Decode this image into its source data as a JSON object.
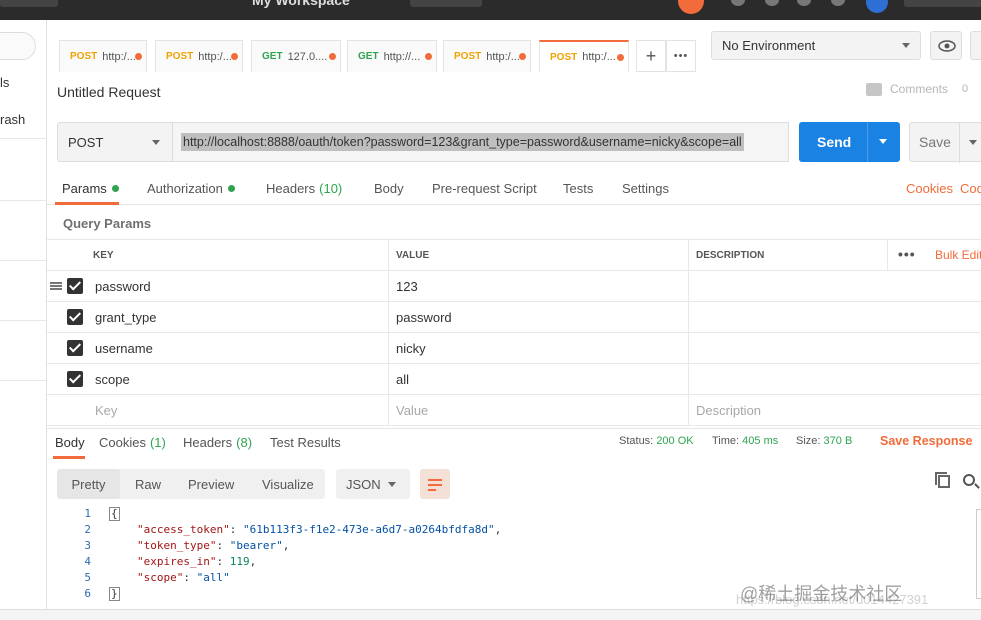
{
  "topbar": {
    "workspace": "My Workspace"
  },
  "sidebar": {
    "items": [
      "ls",
      "rash"
    ]
  },
  "tabs": [
    {
      "method": "POST",
      "url": "http:/...",
      "active": false
    },
    {
      "method": "POST",
      "url": "http:/...",
      "active": false
    },
    {
      "method": "GET",
      "url": "127.0....",
      "active": false
    },
    {
      "method": "GET",
      "url": "http://...",
      "active": false
    },
    {
      "method": "POST",
      "url": "http:/...",
      "active": false
    },
    {
      "method": "POST",
      "url": "http:/...",
      "active": true
    }
  ],
  "tab_buttons": {
    "add": "+",
    "more": "•••"
  },
  "environment": {
    "selected": "No Environment"
  },
  "request": {
    "title": "Untitled Request",
    "comments_label": "Comments",
    "comments_count": "0",
    "method": "POST",
    "url": "http://localhost:8888/oauth/token?password=123&grant_type=password&username=nicky&scope=all",
    "send_label": "Send",
    "save_label": "Save"
  },
  "request_tabs": {
    "params": "Params",
    "authorization": "Authorization",
    "headers": "Headers",
    "headers_count": "(10)",
    "body": "Body",
    "prerequest": "Pre-request Script",
    "tests": "Tests",
    "settings": "Settings",
    "cookies_link": "Cookies",
    "code_link": "Code"
  },
  "query_params": {
    "title": "Query Params",
    "headers": {
      "key": "KEY",
      "value": "VALUE",
      "description": "DESCRIPTION",
      "bulk_edit": "Bulk Edit"
    },
    "rows": [
      {
        "key": "password",
        "value": "123",
        "checked": true
      },
      {
        "key": "grant_type",
        "value": "password",
        "checked": true
      },
      {
        "key": "username",
        "value": "nicky",
        "checked": true
      },
      {
        "key": "scope",
        "value": "all",
        "checked": true
      }
    ],
    "placeholder": {
      "key": "Key",
      "value": "Value",
      "description": "Description"
    }
  },
  "response": {
    "tabs": {
      "body": "Body",
      "cookies": "Cookies",
      "cookies_count": "(1)",
      "headers": "Headers",
      "headers_count": "(8)",
      "test_results": "Test Results"
    },
    "status_label": "Status:",
    "status_value": "200 OK",
    "time_label": "Time:",
    "time_value": "405 ms",
    "size_label": "Size:",
    "size_value": "370 B",
    "save_response": "Save Response",
    "format_buttons": [
      "Pretty",
      "Raw",
      "Preview",
      "Visualize"
    ],
    "format_selected": "JSON",
    "code_lines": [
      {
        "num": "1",
        "text": "{"
      },
      {
        "num": "2",
        "key": "\"access_token\"",
        "sep": ": ",
        "val": "\"61b113f3-f1e2-473e-a6d7-a0264bfdfa8d\"",
        "tail": ","
      },
      {
        "num": "3",
        "key": "\"token_type\"",
        "sep": ": ",
        "val": "\"bearer\"",
        "tail": ","
      },
      {
        "num": "4",
        "key": "\"expires_in\"",
        "sep": ": ",
        "val": "119",
        "tail": ","
      },
      {
        "num": "5",
        "key": "\"scope\"",
        "sep": ": ",
        "val": "\"all\"",
        "tail": ""
      },
      {
        "num": "6",
        "text": "}"
      }
    ]
  },
  "watermark": {
    "text": "@稀土掘金技术社区",
    "url": "https://blog.csdn.net/u014427391"
  }
}
